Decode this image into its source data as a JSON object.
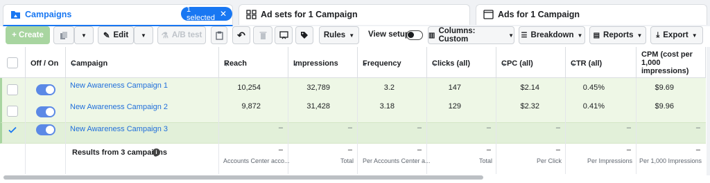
{
  "tabs": [
    {
      "label": "Campaigns",
      "icon": "folder-icon",
      "selected_badge": "1 selected"
    },
    {
      "label": "Ad sets for 1 Campaign",
      "icon": "grid-icon"
    },
    {
      "label": "Ads for 1 Campaign",
      "icon": "window-icon"
    }
  ],
  "toolbar": {
    "create": "+ Create",
    "edit": "Edit",
    "ab_test": "A/B test",
    "rules": "Rules",
    "view_setup": "View setup",
    "columns": "Columns: Custom",
    "breakdown": "Breakdown",
    "reports": "Reports",
    "export": "Export"
  },
  "columns": {
    "off_on": "Off / On",
    "campaign": "Campaign",
    "reach": "Reach",
    "impressions": "Impressions",
    "frequency": "Frequency",
    "clicks": "Clicks (all)",
    "cpc": "CPC (all)",
    "ctr": "CTR (all)",
    "cpm_1": "CPM (cost per",
    "cpm_2": "1,000",
    "cpm_3": "impressions)"
  },
  "rows": [
    {
      "name": "New Awareness Campaign 1",
      "reach": "10,254",
      "impressions": "32,789",
      "frequency": "3.2",
      "clicks": "147",
      "cpc": "$2.14",
      "ctr": "0.45%",
      "cpm": "$9.69",
      "checked": false
    },
    {
      "name": "New Awareness Campaign 2",
      "reach": "9,872",
      "impressions": "31,428",
      "frequency": "3.18",
      "clicks": "129",
      "cpc": "$2.32",
      "ctr": "0.41%",
      "cpm": "$9.96",
      "checked": false
    },
    {
      "name": "New Awareness Campaign 3",
      "reach": "–",
      "impressions": "–",
      "frequency": "–",
      "clicks": "–",
      "cpc": "–",
      "ctr": "–",
      "cpm": "–",
      "checked": true
    }
  ],
  "results": {
    "label": "Results from 3 campaigns",
    "dash": "–",
    "reach": "Accounts Center acco...",
    "impressions": "Total",
    "frequency": "Per Accounts Center a...",
    "clicks": "Total",
    "cpc": "Per Click",
    "ctr": "Per Impressions",
    "cpm": "Per 1,000 Impressions"
  },
  "colors": {
    "accent": "#1877f2",
    "row_highlight": "#eef7e6",
    "row_selected": "#e2f0d9"
  }
}
